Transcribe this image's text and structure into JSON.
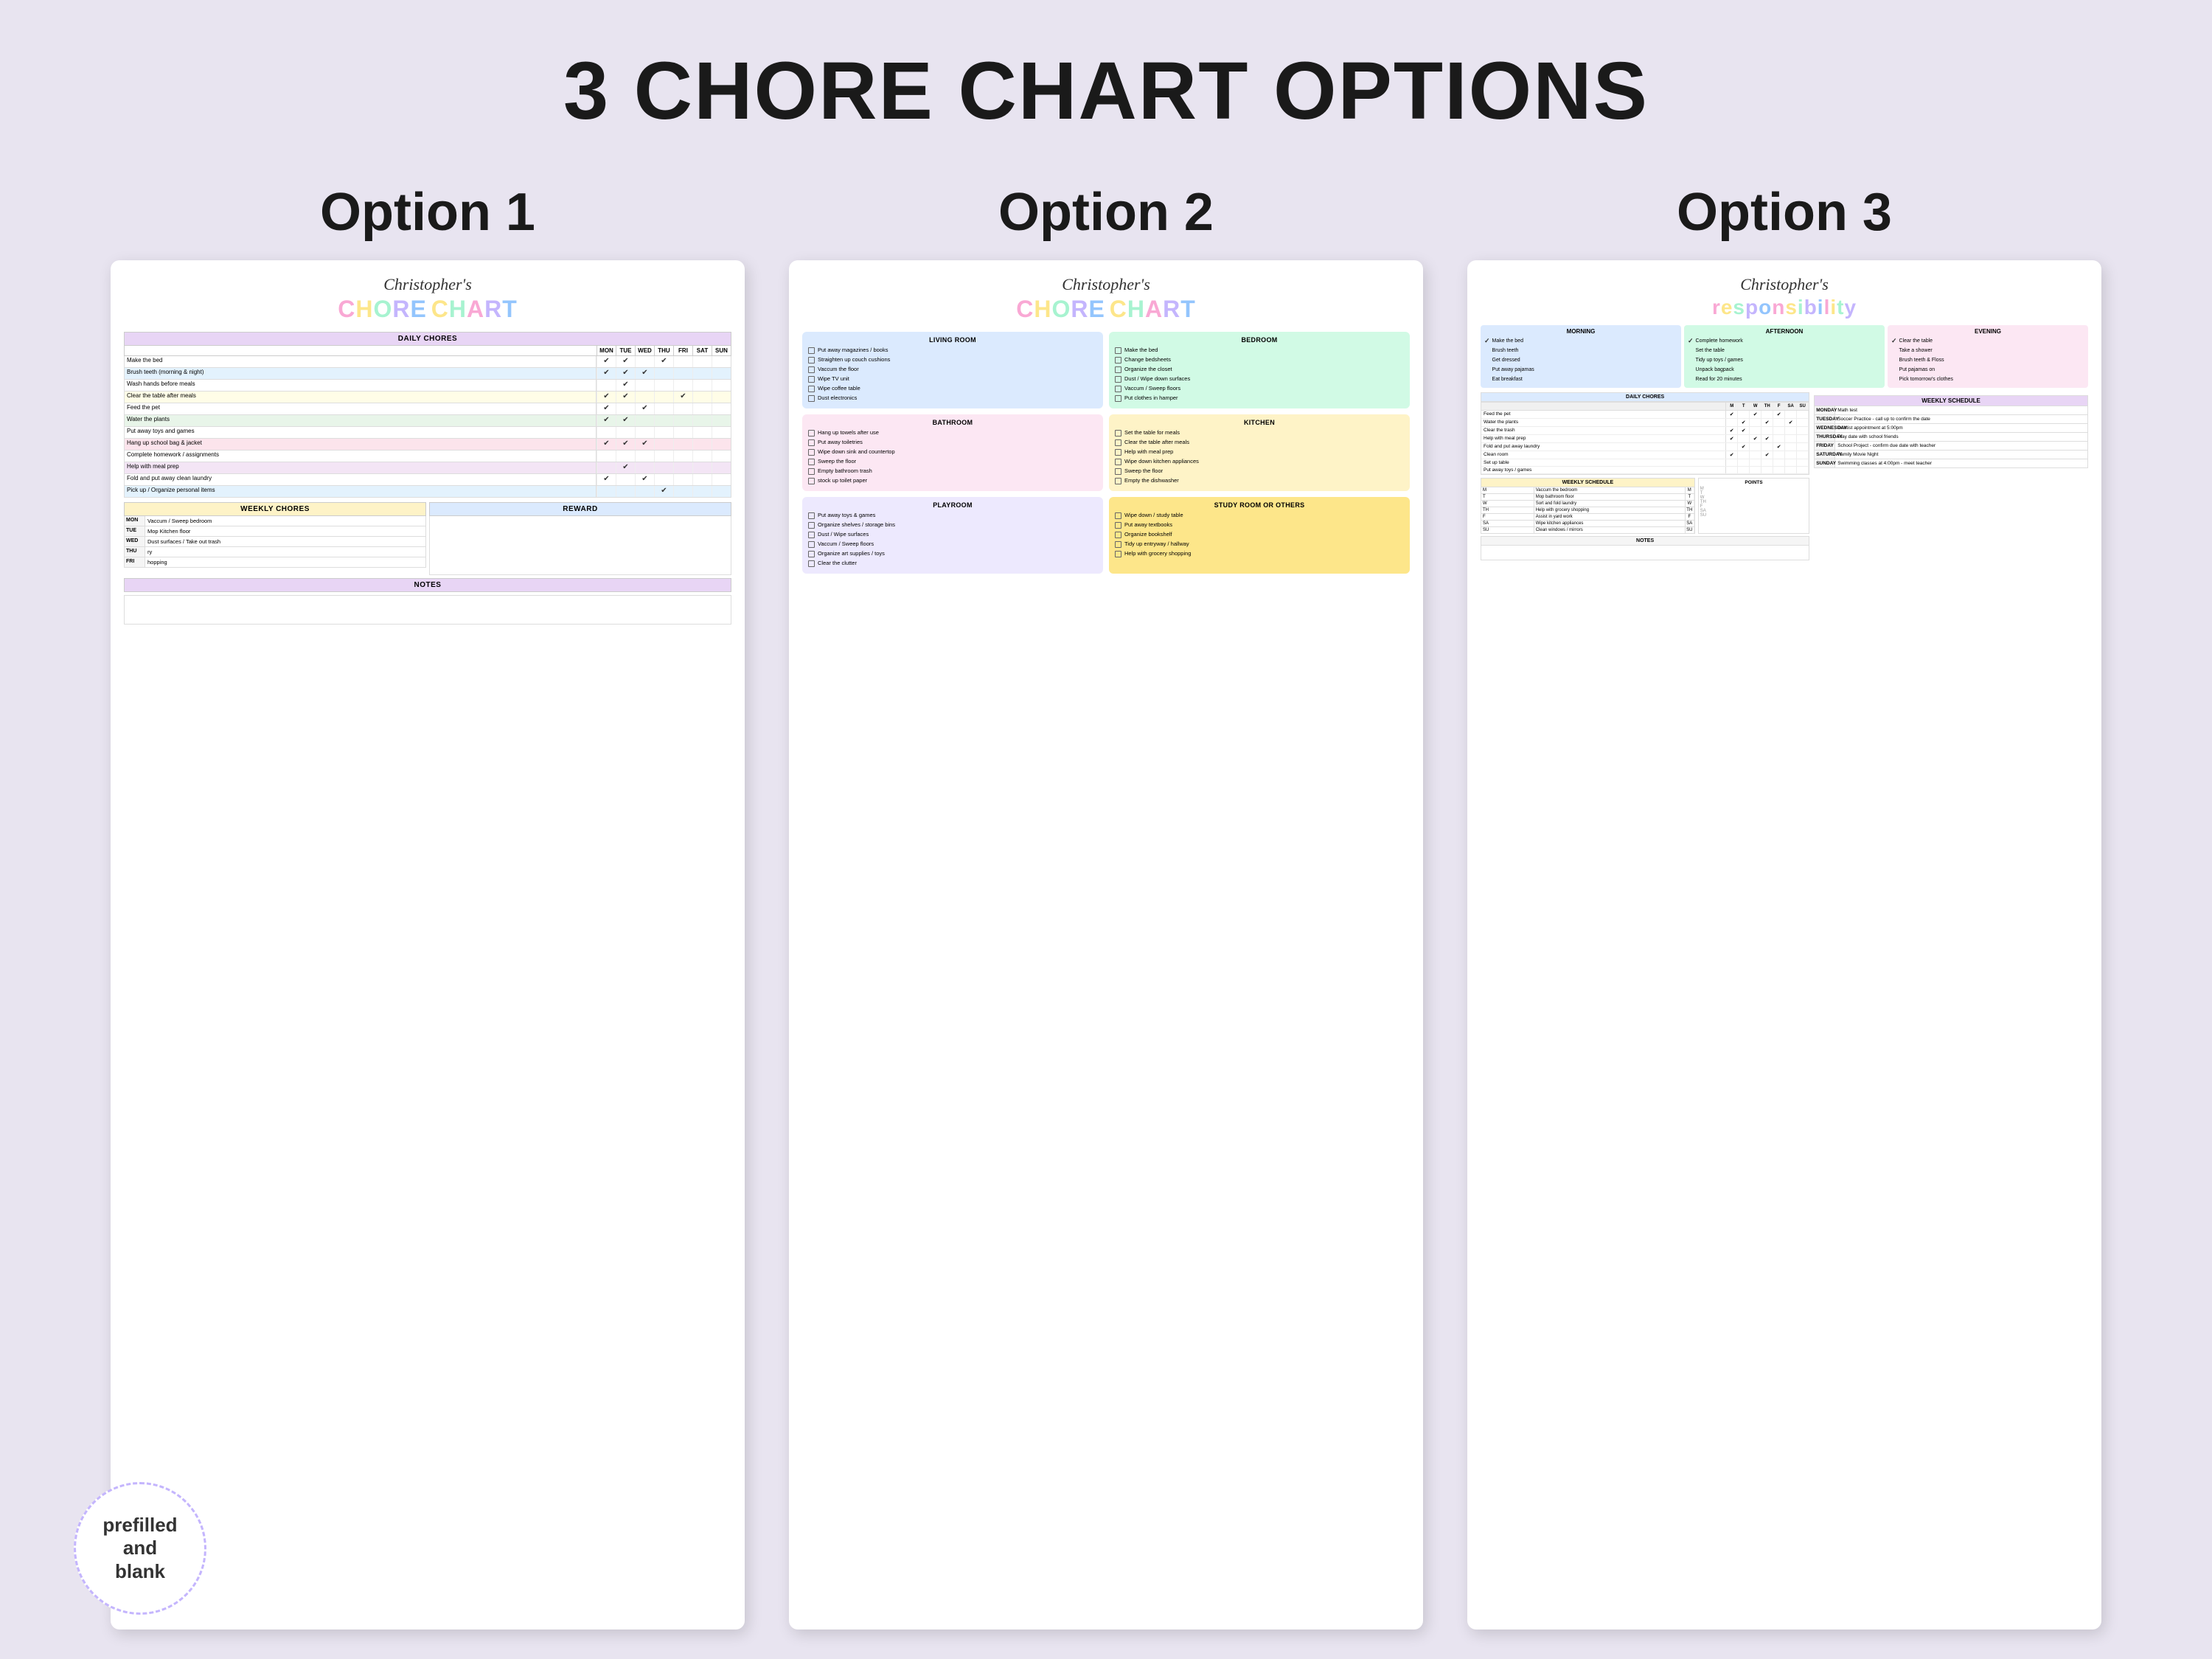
{
  "mainTitle": "3 CHORE CHART OPTIONS",
  "badge": "prefilled\nand\nblank",
  "options": [
    {
      "title": "Option 1",
      "personName": "Christopher's",
      "chartTitle": [
        "C",
        "H",
        "O",
        "R",
        "E",
        "C",
        "H",
        "A",
        "R",
        "T"
      ],
      "choreSections": {
        "daily": {
          "header": "DAILY CHORES",
          "days": [
            "MON",
            "TUE",
            "WED",
            "THU",
            "FRI",
            "SAT",
            "SUN"
          ],
          "rows": [
            {
              "label": "Make the bed",
              "checks": [
                "✔",
                "✔",
                "",
                "✔",
                "",
                "",
                ""
              ]
            },
            {
              "label": "Brush teeth (morning & night)",
              "checks": [
                "✔",
                "✔",
                "✔",
                "",
                "",
                "",
                ""
              ]
            },
            {
              "label": "Wash hands before meals",
              "checks": [
                "",
                "✔",
                "",
                "",
                "",
                "",
                ""
              ]
            },
            {
              "label": "Clear the table after meals",
              "checks": [
                "✔",
                "✔",
                "",
                "",
                "✔",
                "",
                ""
              ]
            },
            {
              "label": "Feed the pet",
              "checks": [
                "✔",
                "",
                "✔",
                "",
                "",
                "",
                ""
              ]
            },
            {
              "label": "Water the plants",
              "checks": [
                "✔",
                "✔",
                "",
                "",
                "",
                "",
                ""
              ]
            },
            {
              "label": "Put away toys and games",
              "checks": [
                "",
                "",
                "",
                "",
                "",
                "",
                ""
              ]
            },
            {
              "label": "Hang up school bag & jacket",
              "checks": [
                "✔",
                "✔",
                "✔",
                "",
                "",
                "",
                ""
              ]
            },
            {
              "label": "Complete homework / assignments",
              "checks": [
                "",
                "",
                "",
                "",
                "",
                "",
                ""
              ]
            },
            {
              "label": "Help with meal prep",
              "checks": [
                "",
                "✔",
                "",
                "",
                "",
                "",
                ""
              ]
            },
            {
              "label": "Fold and put away clean laundry",
              "checks": [
                "✔",
                "",
                "✔",
                "",
                "",
                "",
                ""
              ]
            },
            {
              "label": "Pick up / Organize personal items",
              "checks": [
                "",
                "",
                "",
                "✔",
                "",
                "",
                ""
              ]
            }
          ]
        },
        "weekly": {
          "header": "WEEKLY CHORES",
          "rewardHeader": "REWARD",
          "rows": [
            {
              "day": "MON",
              "task": "Vaccum / Sweep bedroom"
            },
            {
              "day": "TUE",
              "task": "Mop Kitchen floor"
            },
            {
              "day": "WED",
              "task": "Dust surfaces / Take out trash"
            },
            {
              "day": "THU",
              "task": "ry"
            },
            {
              "day": "FRI",
              "task": "hopping"
            }
          ]
        },
        "notes": "NOTES"
      }
    },
    {
      "title": "Option 2",
      "personName": "Christopher's",
      "chartTitle": [
        "C",
        "H",
        "O",
        "R",
        "E",
        "C",
        "H",
        "A",
        "R",
        "T"
      ],
      "sections": [
        {
          "name": "LIVING ROOM",
          "color": "opt2-living",
          "items": [
            "Put away magazines / books",
            "Straighten up couch cushions",
            "Vaccum the floor",
            "Wipe TV unit",
            "Wipe coffee table",
            "Dust electronics"
          ]
        },
        {
          "name": "BEDROOM",
          "color": "opt2-bedroom",
          "items": [
            "Make the bed",
            "Change bedsheets",
            "Organize the closet",
            "Dust / Wipe down surfaces",
            "Vaccum / Sweep floors",
            "Put clothes in hamper"
          ]
        },
        {
          "name": "BATHROOM",
          "color": "opt2-bathroom",
          "items": [
            "Hang up towels after use",
            "Put away toiletries",
            "Wipe down sink and countertop",
            "Sweep the floor",
            "Empty bathroom trash",
            "stock up toilet paper"
          ]
        },
        {
          "name": "KITCHEN",
          "color": "opt2-kitchen",
          "items": [
            "Set the table for meals",
            "Clear the table after meals",
            "Help with meal prep",
            "Wipe down kitchen appliances",
            "Sweep the floor",
            "Empty the dishwasher"
          ]
        },
        {
          "name": "PLAYROOM",
          "color": "opt2-playroom",
          "items": [
            "Put away toys & games",
            "Organize shelves / storage bins",
            "Dust / Wipe surfaces",
            "Vaccum / Sweep floors",
            "Organize art supplies / toys",
            "Clear the clutter"
          ]
        },
        {
          "name": "STUDY ROOM OR OTHERS",
          "color": "opt2-study",
          "items": [
            "Wipe down / study table",
            "Put away textbooks",
            "Organize bookshelf",
            "Tidy up entryway / hallway",
            "Help with grocery shopping"
          ]
        }
      ]
    },
    {
      "title": "Option 3",
      "personName": "Christopher's",
      "chartTitle": "responsibility",
      "morning": {
        "header": "MORNING",
        "items": [
          {
            "check": true,
            "label": "Make the bed"
          },
          {
            "check": false,
            "label": "Brush teeth"
          },
          {
            "check": false,
            "label": "Get dressed"
          },
          {
            "check": false,
            "label": "Put away pajamas"
          },
          {
            "check": false,
            "label": "Eat breakfast"
          }
        ]
      },
      "afternoon": {
        "header": "AFTERNOON",
        "items": [
          {
            "check": true,
            "label": "Complete homework"
          },
          {
            "check": false,
            "label": "Set the table"
          },
          {
            "check": false,
            "label": "Tidy up toys / games"
          },
          {
            "check": false,
            "label": "Unpack bagpack"
          },
          {
            "check": false,
            "label": "Read for 20 minutes"
          }
        ]
      },
      "evening": {
        "header": "EVENING",
        "items": [
          {
            "check": true,
            "label": "Clear the table"
          },
          {
            "check": false,
            "label": "Take a shower"
          },
          {
            "check": false,
            "label": "Brush teeth & Floss"
          },
          {
            "check": false,
            "label": "Put pajamas on"
          },
          {
            "check": false,
            "label": "Pick tomorrow's clothes"
          }
        ]
      },
      "dailyChores": {
        "header": "DAILY CHORES",
        "days": [
          "M",
          "T",
          "W",
          "TH",
          "F",
          "SA",
          "SU"
        ],
        "rows": [
          {
            "task": "Feed the pet",
            "checks": [
              "✔",
              "",
              "✔",
              "",
              "✔",
              "",
              ""
            ]
          },
          {
            "task": "Water the plants",
            "checks": [
              "",
              "✔",
              "",
              "✔",
              "",
              "✔",
              ""
            ]
          },
          {
            "task": "Clear the trash",
            "checks": [
              "✔",
              "✔",
              "",
              "",
              "",
              "",
              ""
            ]
          },
          {
            "task": "Help with meal prep",
            "checks": [
              "✔",
              "",
              "✔",
              "✔",
              "",
              "",
              ""
            ]
          },
          {
            "task": "Fold and put away laundry",
            "checks": [
              "",
              "✔",
              "",
              "",
              "✔",
              "",
              ""
            ]
          },
          {
            "task": "Clean room",
            "checks": [
              "✔",
              "",
              "",
              "✔",
              "",
              "",
              ""
            ]
          },
          {
            "task": "Set up table",
            "checks": [
              "",
              "",
              "",
              "",
              "",
              "",
              ""
            ]
          },
          {
            "task": "Put away toys / games",
            "checks": [
              "",
              "",
              "",
              "",
              "",
              "",
              ""
            ]
          }
        ]
      },
      "weeklySchedule": {
        "header": "WEEKLY SCHEDULE",
        "pointsHeader": "POINTS",
        "rows": [
          {
            "day": "M",
            "task": "Vaccum the bedroom",
            "points": ""
          },
          {
            "day": "T",
            "task": "Mop bathroom floor",
            "points": ""
          },
          {
            "day": "W",
            "task": "Sort and fold laundry",
            "points": ""
          },
          {
            "day": "TH",
            "task": "Help with grocery shopping",
            "points": ""
          },
          {
            "day": "F",
            "task": "Assist in yard work",
            "points": ""
          },
          {
            "day": "SA",
            "task": "Wipe kitchen appliances",
            "points": ""
          },
          {
            "day": "SU",
            "task": "Clean windows / mirrors",
            "points": ""
          }
        ]
      },
      "weeklyEvents": {
        "header": "WEEKLY SCHEDULE",
        "rows": [
          {
            "day": "MONDAY",
            "event": "Math test"
          },
          {
            "day": "TUESDAY",
            "event": "Soccer Practice - call up to confirm the date"
          },
          {
            "day": "WEDNESDAY",
            "event": "Dentist appointment at 5:00pm"
          },
          {
            "day": "THURSDAY",
            "event": "Play date with school friends"
          },
          {
            "day": "FRIDAY",
            "event": "School Project - confirm due date with teacher"
          },
          {
            "day": "SATURDAY",
            "event": "Family Movie Night"
          },
          {
            "day": "SUNDAY",
            "event": "Swimming classes at 4:00pm - meet teacher"
          }
        ]
      },
      "notes": "NOTES"
    }
  ]
}
